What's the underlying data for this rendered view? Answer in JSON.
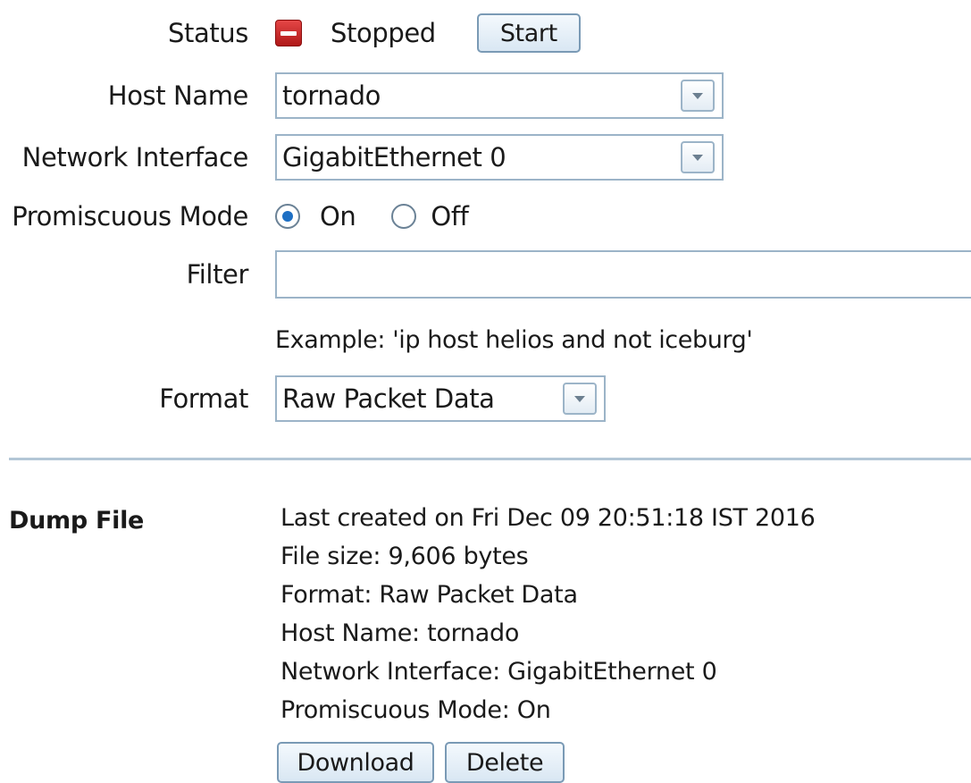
{
  "labels": {
    "status": "Status",
    "host_name": "Host Name",
    "network_interface": "Network Interface",
    "promiscuous_mode": "Promiscuous Mode",
    "filter": "Filter",
    "format": "Format",
    "dump_file": "Dump File"
  },
  "status": {
    "icon": "stop-icon",
    "icon_color": "#c62828",
    "text": "Stopped",
    "start_button": "Start"
  },
  "host_name": {
    "value": "tornado"
  },
  "network_interface": {
    "value": "GigabitEthernet 0"
  },
  "promiscuous_mode": {
    "options": [
      {
        "label": "On",
        "selected": true
      },
      {
        "label": "Off",
        "selected": false
      }
    ]
  },
  "filter": {
    "value": "",
    "example": "Example: 'ip host helios and not iceburg'"
  },
  "format": {
    "value": "Raw Packet Data"
  },
  "dump_file": {
    "lines": [
      "Last created on Fri Dec 09 20:51:18 IST 2016",
      "File size: 9,606 bytes",
      "Format: Raw Packet Data",
      "Host Name: tornado",
      "Network Interface: GigabitEthernet 0",
      "Promiscuous Mode: On"
    ],
    "download_button": "Download",
    "delete_button": "Delete"
  },
  "colors": {
    "accent": "#1d6fc4",
    "border": "#9cb4c8",
    "divider": "#b3c6d6"
  }
}
